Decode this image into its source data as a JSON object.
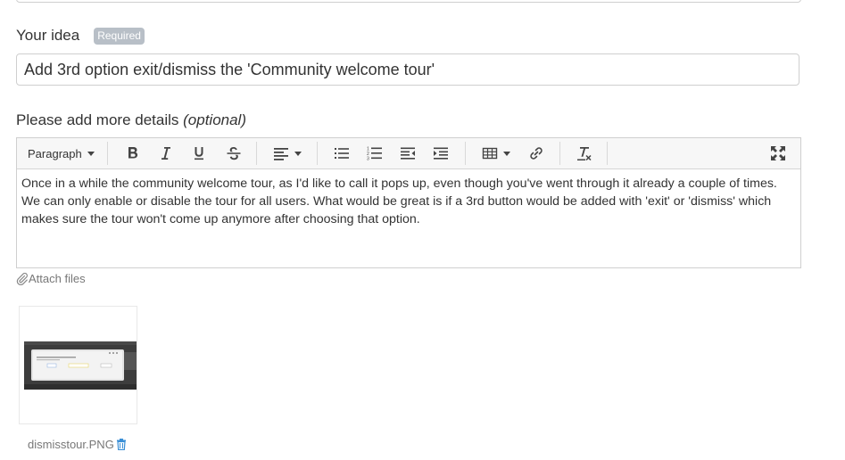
{
  "idea": {
    "label": "Your idea",
    "required_badge": "Required",
    "value": "Add 3rd option exit/dismiss the 'Community welcome tour'"
  },
  "details": {
    "label": "Please add more details",
    "optional": "(optional)"
  },
  "editor": {
    "format_dropdown": "Paragraph",
    "toolbar_icons": [
      "bold-icon",
      "italic-icon",
      "underline-icon",
      "strikethrough-icon",
      "align-icon",
      "bullet-list-icon",
      "numbered-list-icon",
      "outdent-icon",
      "indent-icon",
      "table-icon",
      "link-icon",
      "clear-format-icon",
      "fullscreen-icon"
    ],
    "content": "Once in a while the community welcome tour, as I'd like to call it pops up, even though you've went through it already a couple of times. We can only enable or disable the tour for all users. What would be great is if a 3rd button would be added with 'exit' or 'dismiss' which makes sure the tour won't come up anymore after choosing that option."
  },
  "attachments": {
    "attach_label": "Attach files",
    "files": [
      {
        "name": "dismisstour.PNG"
      }
    ]
  },
  "colors": {
    "badge": "#b8bfc7",
    "border": "#cfcfcf",
    "toolbar_bg": "#f7f7f7",
    "trash": "#3a8fd6"
  }
}
